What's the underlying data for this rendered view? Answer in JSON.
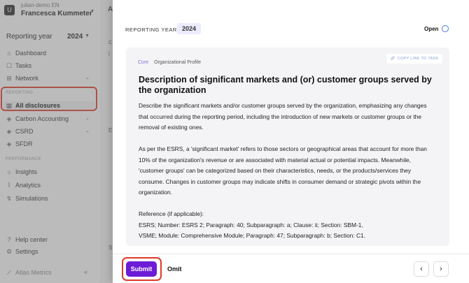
{
  "sidebar": {
    "org_avatar": "U",
    "org_line1": "julian-demo EN",
    "org_line2": "Francesca Kummeter",
    "reporting_year_label": "Reporting year",
    "reporting_year_value": "2024",
    "nav_top": [
      {
        "label": "Dashboard",
        "icon": "home-icon"
      },
      {
        "label": "Tasks",
        "icon": "tasks-icon"
      },
      {
        "label": "Network",
        "icon": "network-icon"
      }
    ],
    "section_reporting": "REPORTING",
    "all_disclosures": "All disclosures",
    "reporting_items": [
      {
        "label": "Carbon Accounting"
      },
      {
        "label": "CSRD"
      },
      {
        "label": "SFDR"
      }
    ],
    "section_performance": "PERFORMANCE",
    "performance_items": [
      {
        "label": "Insights"
      },
      {
        "label": "Analytics"
      },
      {
        "label": "Simulations"
      }
    ],
    "help_center": "Help center",
    "settings": "Settings",
    "brand": "Atlas Metrics"
  },
  "drawer": {
    "reporting_year_label": "REPORTING YEAR",
    "reporting_year_value": "2024",
    "status": "Open",
    "tag_core": "Core",
    "tag_category": "Organizational Profile",
    "copy_link": "COPY LINK TO TASK",
    "title": "Description of significant markets and (or) customer groups served by the organization",
    "paragraphs": [
      "Describe the significant markets and/or customer groups served by the organization, emphasizing any changes that occurred during the reporting period, including the introduction of new markets or customer groups or the removal of existing ones.",
      "As per the ESRS, a 'significant market' refers to those sectors or geographical areas that account for more than 10% of the organization's revenue or are associated with material actual or potential impacts. Meanwhile, 'customer groups' can be categorized based on their characteristics, needs, or the products/services they consume. Changes in customer groups may indicate shifts in consumer demand or strategic pivots within the organization."
    ],
    "reference_title": "Reference (if applicable):",
    "reference_line1": "ESRS; Number: ESRS 2; Paragraph: 40; Subparagraph: a; Clause: ii; Section: SBM-1,",
    "reference_line2": "VSME; Module: Comprehensive Module; Paragraph: 47; Subparagraph: b; Section: C1.",
    "submit": "Submit",
    "omit": "Omit",
    "prev_glyph": "‹",
    "next_glyph": "›"
  },
  "colors": {
    "accent": "#6c1bd6",
    "callout": "#e0392b",
    "tag_core": "#8a6cd8",
    "status_circle": "#4a78e0"
  }
}
